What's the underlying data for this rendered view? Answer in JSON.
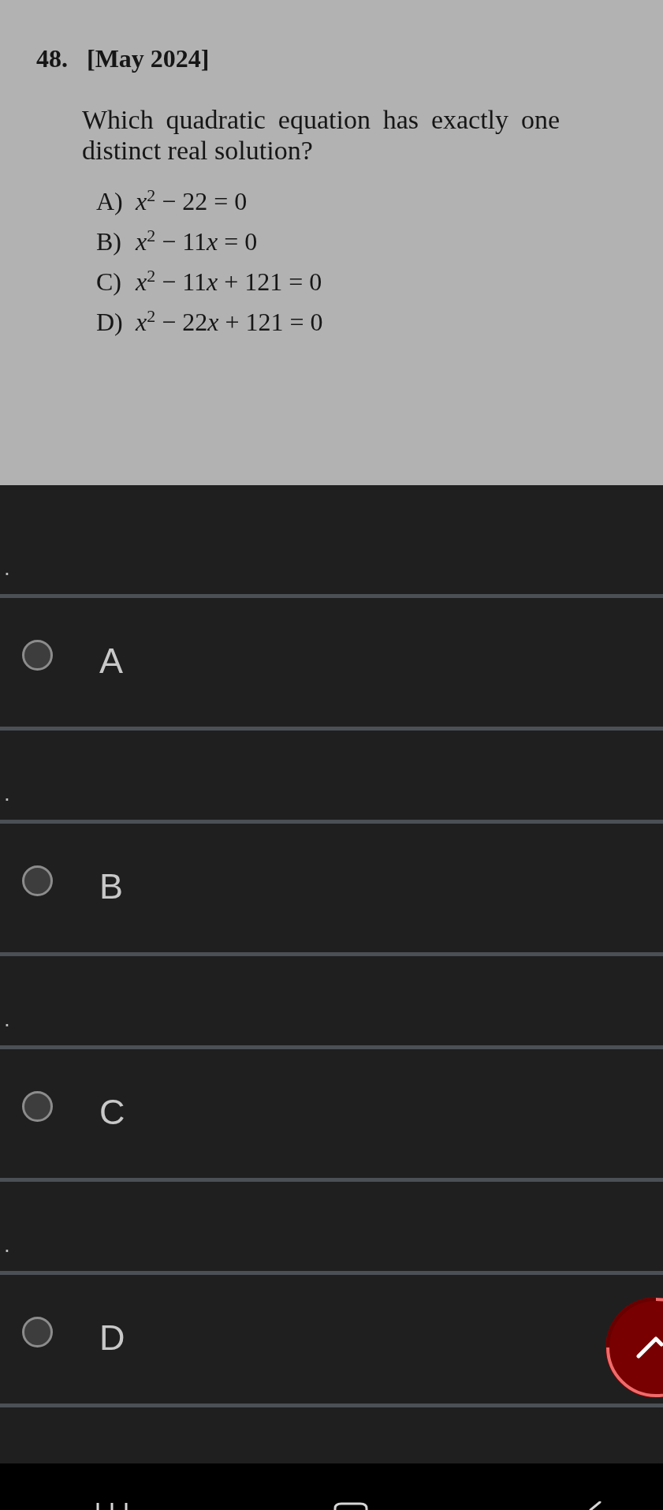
{
  "question": {
    "number": "48.",
    "source": "[May 2024]",
    "text": "Which quadratic equation has exactly one distinct real solution?",
    "options": [
      {
        "label": "A)",
        "equation": [
          {
            "kind": "var",
            "text": "x"
          },
          {
            "kind": "sup",
            "text": "2"
          },
          {
            "kind": "text",
            "text": " − 22 = 0"
          }
        ]
      },
      {
        "label": "B)",
        "equation": [
          {
            "kind": "var",
            "text": "x"
          },
          {
            "kind": "sup",
            "text": "2"
          },
          {
            "kind": "text",
            "text": " − 11"
          },
          {
            "kind": "var",
            "text": "x"
          },
          {
            "kind": "text",
            "text": " = 0"
          }
        ]
      },
      {
        "label": "C)",
        "equation": [
          {
            "kind": "var",
            "text": "x"
          },
          {
            "kind": "sup",
            "text": "2"
          },
          {
            "kind": "text",
            "text": " − 11"
          },
          {
            "kind": "var",
            "text": "x"
          },
          {
            "kind": "text",
            "text": " + 121 = 0"
          }
        ]
      },
      {
        "label": "D)",
        "equation": [
          {
            "kind": "var",
            "text": "x"
          },
          {
            "kind": "sup",
            "text": "2"
          },
          {
            "kind": "text",
            "text": " − 22"
          },
          {
            "kind": "var",
            "text": "x"
          },
          {
            "kind": "text",
            "text": " + 121 = 0"
          }
        ]
      }
    ]
  },
  "answer_choices": [
    {
      "prompt": ".",
      "label": "A",
      "selected": false
    },
    {
      "prompt": ".",
      "label": "B",
      "selected": false
    },
    {
      "prompt": ".",
      "label": "C",
      "selected": false
    },
    {
      "prompt": ".",
      "label": "D",
      "selected": false
    }
  ]
}
